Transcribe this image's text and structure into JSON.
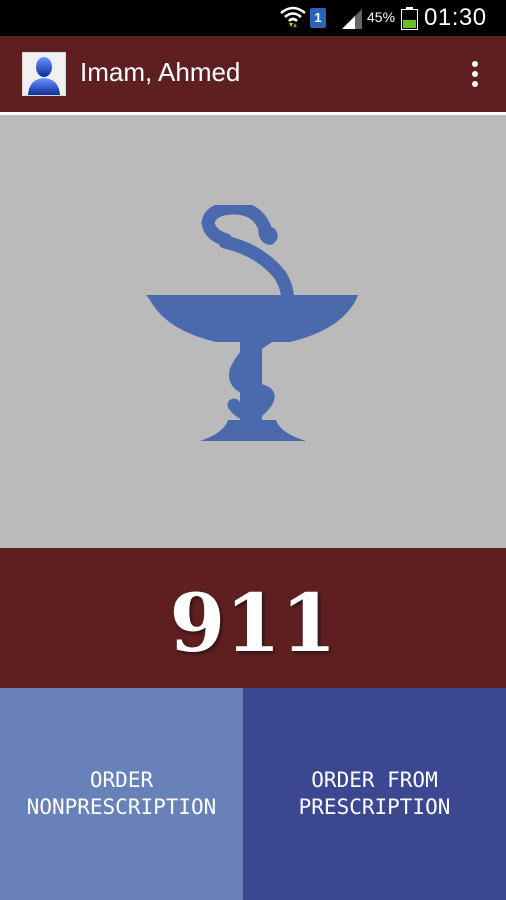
{
  "status_bar": {
    "sim_slot": "1",
    "battery_percent": "45%",
    "time": "01:30",
    "battery_level": 0.45
  },
  "app_bar": {
    "title": "Imam, Ahmed",
    "avatar_icon": "person-silhouette-icon",
    "menu_icon": "overflow-menu-icon"
  },
  "hero": {
    "icon": "bowl-of-hygieia-icon",
    "icon_color": "#4a6aad",
    "background": "#bababa"
  },
  "emergency": {
    "label": "911",
    "background": "#5d1f20"
  },
  "actions": {
    "nonprescription": {
      "label": "ORDER\nNONPRESCRIPTION",
      "background": "#6881b9"
    },
    "prescription": {
      "label": "ORDER FROM\nPRESCRIPTION",
      "background": "#3b4790"
    }
  }
}
